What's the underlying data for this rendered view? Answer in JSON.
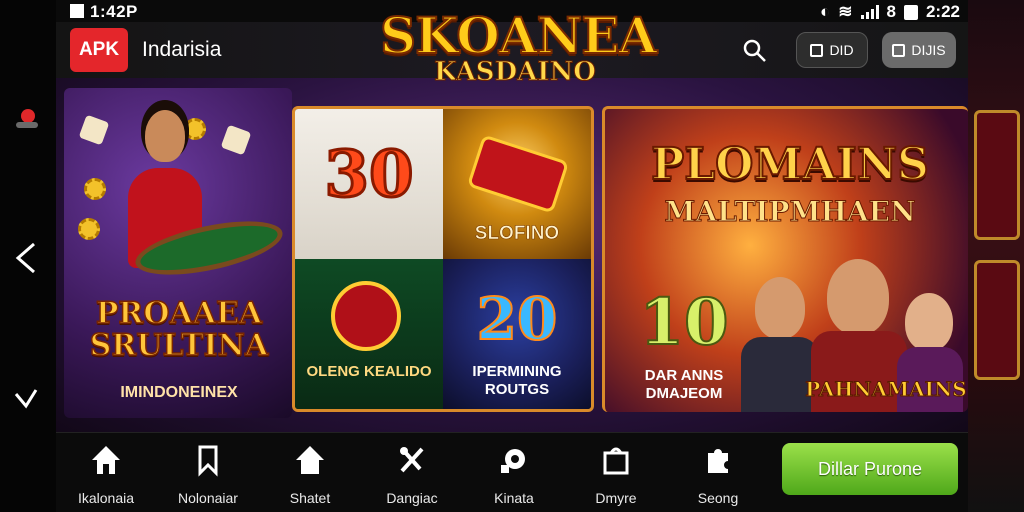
{
  "system": {
    "time_left": "1:42P",
    "time_right": "2:22",
    "icons": [
      "notification-icon",
      "wifi-icon",
      "signal-icon",
      "battery-icon"
    ]
  },
  "header": {
    "apk_label": "APK",
    "region": "Indarisia",
    "button1_label": "DID",
    "button2_label": "DIJIS"
  },
  "logo": {
    "line1": "SKOANEA",
    "line2": "KASDAINO"
  },
  "promo_left": {
    "title": "PROAAEA SRULTINA",
    "subtitle": "IMINDONEINEX"
  },
  "promo_center": {
    "cell1_number": "30",
    "cell2_caption": "SLOFINO",
    "cell3_caption": "OLENG KEALIDO",
    "cell4_number": "20",
    "cell4_caption": "IPERMINING ROUTGS"
  },
  "promo_right": {
    "title": "PLOMAINS",
    "subtitle": "MALTIPMHAEN",
    "number": "10",
    "caption": "DAR ANNS DMAJEOM",
    "banner": "PAHNAMAINS"
  },
  "nav": {
    "items": [
      {
        "label": "Ikalonaia",
        "icon": "home-icon"
      },
      {
        "label": "Nolonaiar",
        "icon": "bookmark-icon"
      },
      {
        "label": "Shatet",
        "icon": "house-icon"
      },
      {
        "label": "Dangiac",
        "icon": "tools-icon"
      },
      {
        "label": "Kinata",
        "icon": "settings-icon"
      },
      {
        "label": "Dmyre",
        "icon": "bag-icon"
      },
      {
        "label": "Seong",
        "icon": "puzzle-icon"
      }
    ],
    "cta_label": "Dillar Purone"
  },
  "colors": {
    "apk_red": "#e4262b",
    "cta_green": "#6cc42a",
    "gold": "#ffcc1a"
  }
}
